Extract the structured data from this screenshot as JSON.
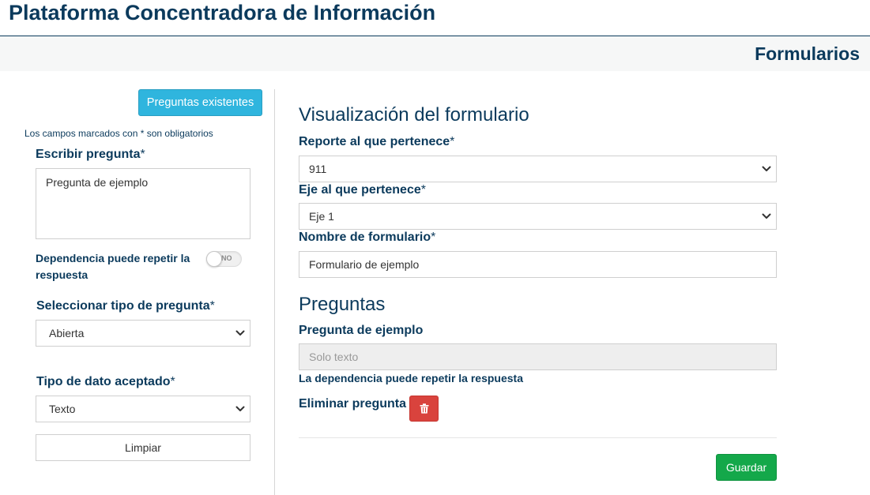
{
  "app": {
    "title": "Plataforma Concentradora de Información"
  },
  "header": {
    "section_title": "Formularios"
  },
  "left": {
    "existing_button": "Preguntas existentes",
    "required_note": "Los campos marcados con * son obligatorios",
    "question_label": "Escribir pregunta",
    "question_value": "Pregunta de ejemplo",
    "dependency_label": "Dependencia puede repetir la respuesta",
    "dependency_toggle": "NO",
    "type_label": "Seleccionar tipo de pregunta",
    "type_value": "Abierta",
    "datatype_label": "Tipo de dato aceptado",
    "datatype_value": "Texto",
    "clear_button": "Limpiar",
    "required_mark": "*"
  },
  "right": {
    "preview_title": "Visualización del formulario",
    "report_label": "Reporte al que pertenece",
    "report_value": "911",
    "axis_label": "Eje al que pertenece",
    "axis_value": "Eje 1",
    "form_name_label": "Nombre de formulario",
    "form_name_value": "Formulario de ejemplo",
    "questions_title": "Preguntas",
    "question_title": "Pregunta de ejemplo",
    "answer_placeholder": "Solo texto",
    "dependency_text": "La dependencia puede repetir la respuesta",
    "delete_label": "Eliminar pregunta",
    "save_button": "Guardar",
    "required_mark": "*"
  },
  "icons": {
    "delete": "trash-icon",
    "dropdown": "chevron-down-icon"
  },
  "colors": {
    "primary_text": "#0b3a5c",
    "info": "#2fb5de",
    "danger": "#d9433d",
    "success": "#14a84a"
  }
}
